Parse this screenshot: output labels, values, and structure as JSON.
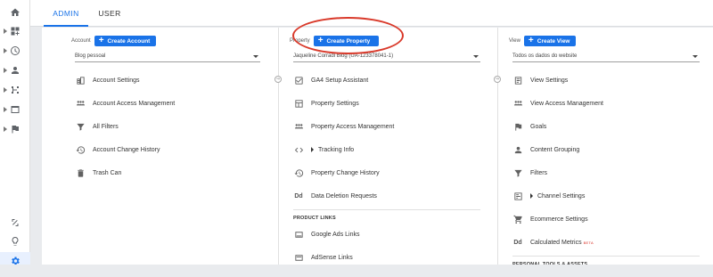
{
  "tabs": {
    "admin": "ADMIN",
    "user": "USER"
  },
  "rail": {
    "items": [
      "home-icon",
      "dashboard-icon",
      "clock-icon",
      "person-icon",
      "acquisition-icon",
      "behavior-icon",
      "flag-icon",
      "link-icon",
      "lightbulb-icon",
      "gear-icon"
    ]
  },
  "account": {
    "label": "Account",
    "create": "Create Account",
    "selected": "Blog pessoal",
    "items": [
      {
        "label": "Account Settings",
        "icon": "building-icon"
      },
      {
        "label": "Account Access Management",
        "icon": "people-icon"
      },
      {
        "label": "All Filters",
        "icon": "filter-icon"
      },
      {
        "label": "Account Change History",
        "icon": "history-icon"
      },
      {
        "label": "Trash Can",
        "icon": "trash-icon"
      }
    ]
  },
  "property": {
    "label": "Property",
    "create": "Create Property",
    "selected": "Jaqueline Corradi Blog (UA-123378041-1)",
    "items": [
      {
        "label": "GA4 Setup Assistant",
        "icon": "checkbox-icon"
      },
      {
        "label": "Property Settings",
        "icon": "layout-icon"
      },
      {
        "label": "Property Access Management",
        "icon": "people-icon"
      },
      {
        "label": "Tracking Info",
        "icon": "code-icon"
      },
      {
        "label": "Property Change History",
        "icon": "history-icon"
      },
      {
        "label": "Data Deletion Requests",
        "icon": "dd-icon"
      }
    ],
    "product_links_header": "PRODUCT LINKS",
    "product_links": [
      {
        "label": "Google Ads Links",
        "icon": "ads-icon"
      },
      {
        "label": "AdSense Links",
        "icon": "adsense-icon"
      }
    ]
  },
  "view": {
    "label": "View",
    "create": "Create View",
    "selected": "Todos os dados do website",
    "items": [
      {
        "label": "View Settings",
        "icon": "document-icon"
      },
      {
        "label": "View Access Management",
        "icon": "people-icon"
      },
      {
        "label": "Goals",
        "icon": "flag-icon"
      },
      {
        "label": "Content Grouping",
        "icon": "person-icon"
      },
      {
        "label": "Filters",
        "icon": "filter-icon"
      },
      {
        "label": "Channel Settings",
        "icon": "channel-icon"
      },
      {
        "label": "Ecommerce Settings",
        "icon": "cart-icon"
      },
      {
        "label": "Calculated Metrics",
        "icon": "dd-icon",
        "badge": "BETA"
      }
    ],
    "personal_header": "PERSONAL TOOLS & ASSETS"
  },
  "colors": {
    "accent": "#1a73e8",
    "highlight": "#d93a2b"
  }
}
